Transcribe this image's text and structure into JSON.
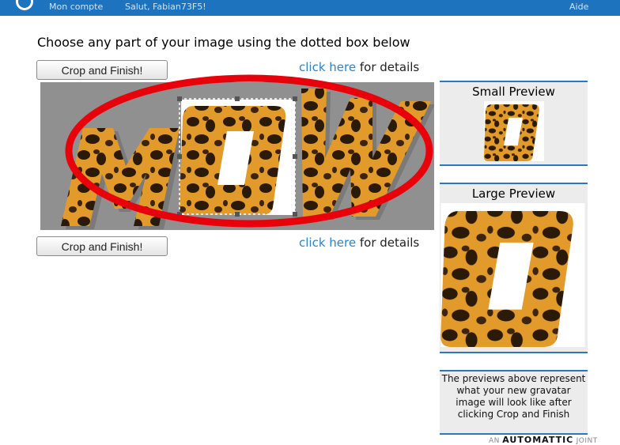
{
  "topbar": {
    "left_text": "Mon compte",
    "middle_text": "Salut, Fabian73F5!",
    "right_text": "Aide"
  },
  "heading": "Choose any part of your image using the dotted box below",
  "crop_button_label": "Crop and Finish!",
  "details": {
    "link": "click here",
    "suffix": " for details"
  },
  "image": {
    "letters": "MOW",
    "pattern": "leopard"
  },
  "small_preview": {
    "title": "Small Preview"
  },
  "large_preview": {
    "title": "Large Preview"
  },
  "info_text": "The previews above represent what your new gravatar image will look like after clicking Crop and Finish",
  "footer": {
    "prefix": "AN ",
    "brand": "AUTOMATTIC",
    "suffix": " JOINT"
  },
  "colors": {
    "accent": "#1e73be",
    "link": "#2f82c4",
    "annotation": "#e8000b"
  }
}
